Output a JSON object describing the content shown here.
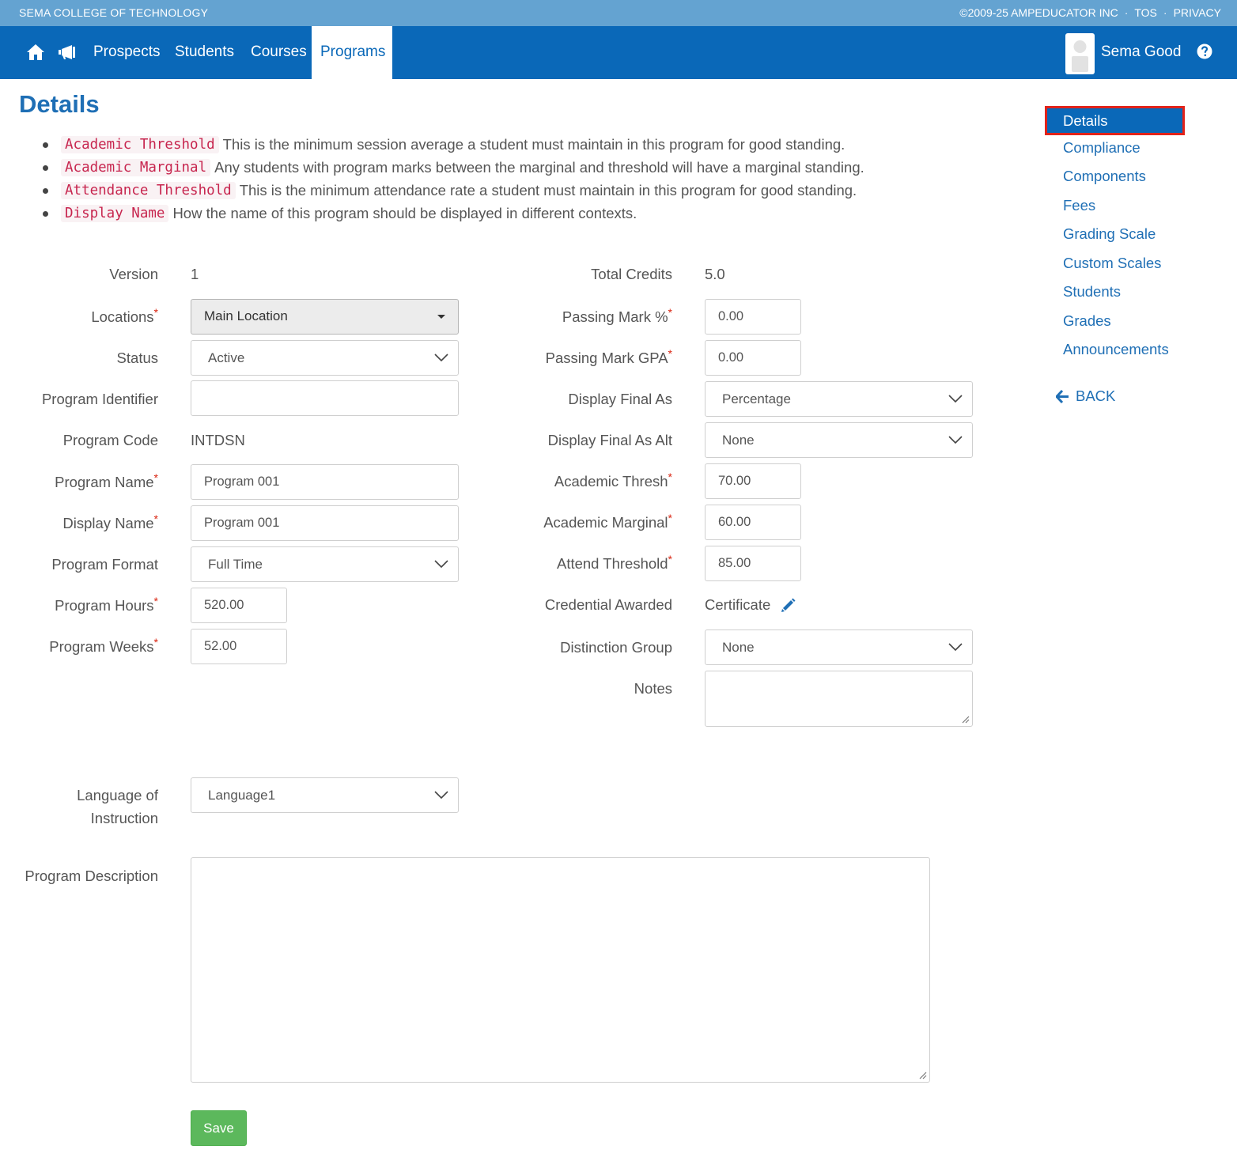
{
  "topbar": {
    "school": "SEMA COLLEGE OF TECHNOLOGY",
    "copyright": "©2009-25 AMPEDUCATOR INC",
    "tos": "TOS",
    "privacy": "PRIVACY",
    "separator": "·"
  },
  "nav": {
    "home_icon": "home-icon",
    "announce_icon": "megaphone-icon",
    "links": [
      "Prospects",
      "Students",
      "Courses",
      "Programs"
    ],
    "active": "Programs",
    "user_name": "Sema Good",
    "help_icon": "question-circle-icon"
  },
  "page": {
    "title": "Details",
    "bullets": [
      {
        "code": "Academic Threshold",
        "text": "This is the minimum session average a student must maintain in this program for good standing."
      },
      {
        "code": "Academic Marginal",
        "text": "Any students with program marks between the marginal and threshold will have a marginal standing."
      },
      {
        "code": "Attendance Threshold",
        "text": "This is the minimum attendance rate a student must maintain in this program for good standing."
      },
      {
        "code": "Display Name",
        "text": "How the name of this program should be displayed in different contexts."
      }
    ]
  },
  "form_left": {
    "version": {
      "label": "Version",
      "value": "1"
    },
    "locations": {
      "label": "Locations",
      "value": "Main Location"
    },
    "status": {
      "label": "Status",
      "value": "Active"
    },
    "program_identifier": {
      "label": "Program Identifier",
      "value": ""
    },
    "program_code": {
      "label": "Program Code",
      "value": "INTDSN"
    },
    "program_name": {
      "label": "Program Name",
      "value": "Program 001"
    },
    "display_name": {
      "label": "Display Name",
      "value": "Program 001"
    },
    "program_format": {
      "label": "Program Format",
      "value": "Full Time"
    },
    "program_hours": {
      "label": "Program Hours",
      "value": "520.00"
    },
    "program_weeks": {
      "label": "Program Weeks",
      "value": "52.00"
    },
    "language": {
      "label_line1": "Language of",
      "label_line2": "Instruction",
      "value": "Language1"
    },
    "description": {
      "label": "Program Description",
      "value": ""
    }
  },
  "form_right": {
    "total_credits": {
      "label": "Total Credits",
      "value": "5.0"
    },
    "passing_mark_pct": {
      "label": "Passing Mark %",
      "value": "0.00"
    },
    "passing_mark_gpa": {
      "label": "Passing Mark GPA",
      "value": "0.00"
    },
    "display_final_as": {
      "label": "Display Final As",
      "value": "Percentage"
    },
    "display_final_as_alt": {
      "label": "Display Final As Alt",
      "value": "None"
    },
    "academic_thresh": {
      "label": "Academic Thresh",
      "value": "70.00"
    },
    "academic_marginal": {
      "label": "Academic Marginal",
      "value": "60.00"
    },
    "attend_threshold": {
      "label": "Attend Threshold",
      "value": "85.00"
    },
    "credential_awarded": {
      "label": "Credential Awarded",
      "value": "Certificate"
    },
    "distinction_group": {
      "label": "Distinction Group",
      "value": "None"
    },
    "notes": {
      "label": "Notes",
      "value": ""
    }
  },
  "required_marker": "*",
  "save_label": "Save",
  "sidenav": {
    "items": [
      "Details",
      "Compliance",
      "Components",
      "Fees",
      "Grading Scale",
      "Custom Scales",
      "Students",
      "Grades",
      "Announcements"
    ],
    "active": "Details",
    "back_label": "BACK"
  },
  "colors": {
    "brand_blue": "#0a68b8",
    "topstrip_blue": "#64a3d1",
    "link_blue": "#1f6fb5",
    "save_green": "#5cb85c",
    "highlight_red": "#e2231a",
    "code_pink": "#c7254e"
  }
}
